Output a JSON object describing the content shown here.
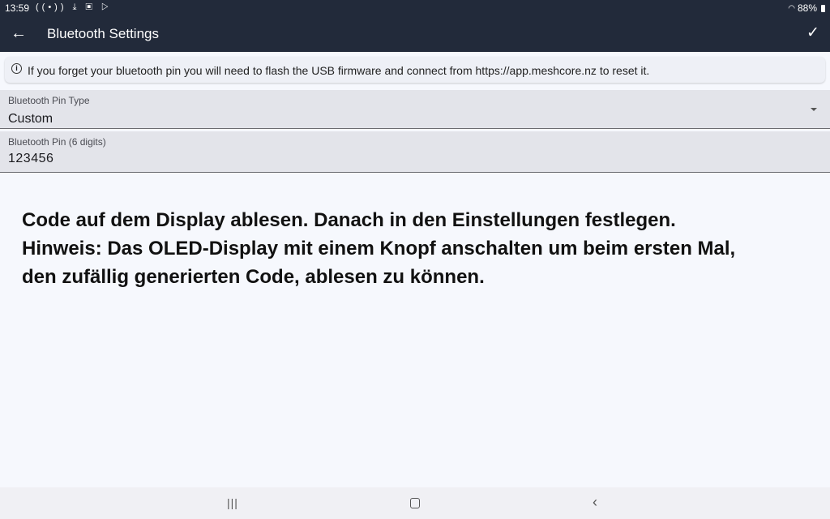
{
  "status_bar": {
    "time": "13:59",
    "notification_icons": [
      "radio-signal-icon",
      "download-icon",
      "image-icon",
      "play-store-icon"
    ],
    "battery": "88%"
  },
  "app_bar": {
    "title": "Bluetooth Settings",
    "back_icon": "arrow-left-icon",
    "confirm_icon": "check-icon"
  },
  "info_banner": {
    "text": "If you forget your bluetooth pin you will need to flash the USB firmware and connect from https://app.meshcore.nz to reset it."
  },
  "pin_type": {
    "label": "Bluetooth Pin Type",
    "value": "Custom"
  },
  "pin": {
    "label": "Bluetooth Pin (6 digits)",
    "value": "123456"
  },
  "overlay_note": {
    "line1": "Code auf dem Display ablesen. Danach in den Einstellungen festlegen.",
    "line2": "Hinweis: Das OLED-Display mit einem Knopf anschalten um beim ersten Mal,",
    "line3": "den zufällig generierten Code, ablesen zu können."
  },
  "colors": {
    "app_bar": "#222a3a",
    "background": "#f6f8fd",
    "field": "#e3e4ea"
  }
}
